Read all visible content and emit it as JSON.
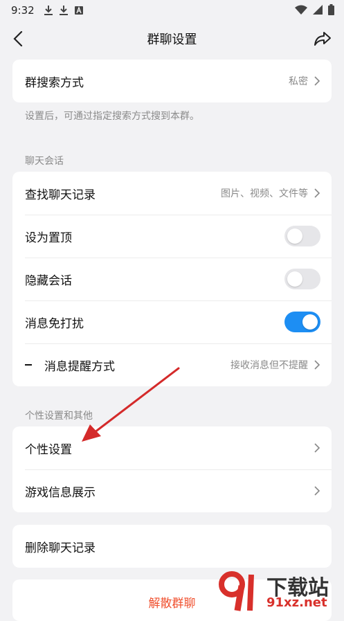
{
  "status": {
    "time": "9:32",
    "icons": [
      "download-icon",
      "download-icon",
      "font-app-icon",
      "wifi-icon",
      "signal-icon",
      "battery-icon"
    ]
  },
  "nav": {
    "title": "群聊设置",
    "back_icon": "chevron-left-icon",
    "share_icon": "share-icon"
  },
  "search_card": {
    "label": "群搜索方式",
    "value": "私密"
  },
  "search_hint": "设置后，可通过指定搜索方式搜到本群。",
  "chat_section": {
    "caption": "聊天会话",
    "items": [
      {
        "label": "查找聊天记录",
        "value": "图片、视频、文件等"
      },
      {
        "label": "设为置顶",
        "toggle": false
      },
      {
        "label": "隐藏会话",
        "toggle": false
      },
      {
        "label": "消息免打扰",
        "toggle": true
      },
      {
        "label": "消息提醒方式",
        "value": "接收消息但不提醒"
      }
    ]
  },
  "personal_section": {
    "caption": "个性设置和其他",
    "items": [
      {
        "label": "个性设置"
      },
      {
        "label": "游戏信息展示"
      }
    ]
  },
  "delete_history": "删除聊天记录",
  "dissolve": "解散群聊",
  "colors": {
    "accent": "#1d8ef3",
    "danger": "#f0512f",
    "annotation_arrow": "#d42a2a"
  },
  "watermark": {
    "big": "下载站",
    "small": "91xz.net"
  }
}
